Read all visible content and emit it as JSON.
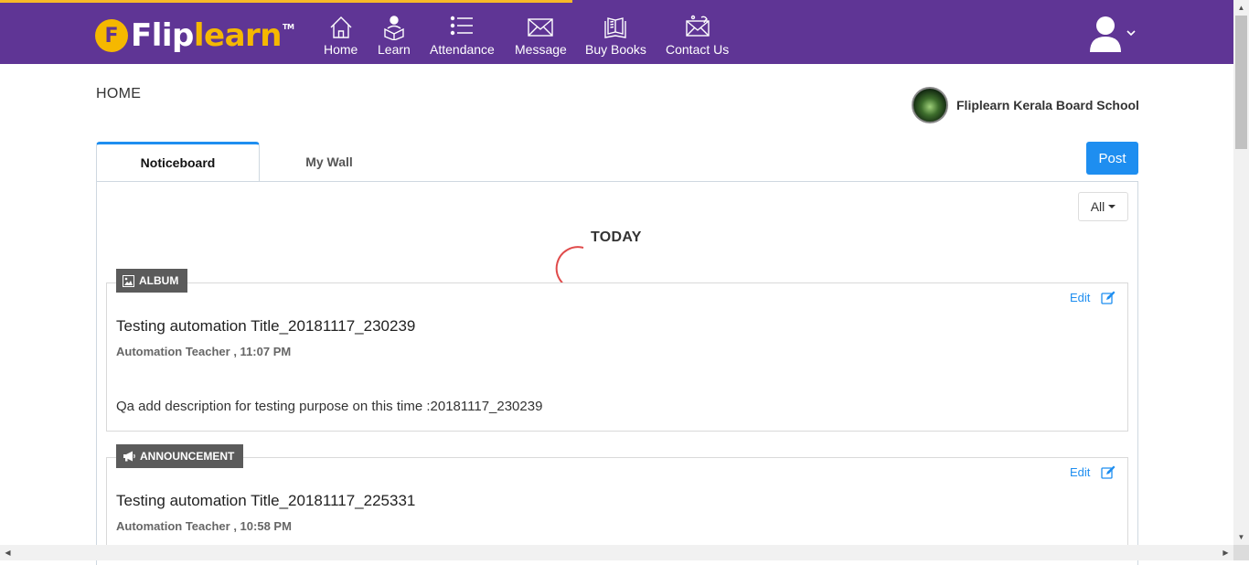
{
  "brand": {
    "part1": "Flip",
    "part2": "learn",
    "tm": "TM",
    "badge": "F"
  },
  "nav": {
    "home": "Home",
    "learn": "Learn",
    "attendance": "Attendance",
    "message": "Message",
    "buy_books": "Buy Books",
    "contact_us": "Contact Us"
  },
  "page": {
    "title": "HOME"
  },
  "school": {
    "name": "Fliplearn Kerala Board School"
  },
  "tabs": [
    {
      "label": "Noticeboard",
      "active": true
    },
    {
      "label": "My Wall",
      "active": false
    }
  ],
  "actions": {
    "post": "Post",
    "filter": "All"
  },
  "feed": {
    "section_label": "TODAY",
    "posts": [
      {
        "type": "ALBUM",
        "edit": "Edit",
        "title": "Testing automation Title_20181117_230239",
        "meta": "Automation Teacher , 11:07 PM",
        "description": "Qa add description for testing purpose on this time :20181117_230239"
      },
      {
        "type": "ANNOUNCEMENT",
        "edit": "Edit",
        "title": "Testing automation Title_20181117_225331",
        "meta": "Automation Teacher , 10:58 PM",
        "description": ""
      }
    ]
  },
  "colors": {
    "topbar": "#5f3595",
    "accent": "#1e8ef0",
    "brand_yellow": "#f5b800",
    "badge": "#5b5b5b"
  },
  "icons": {
    "home": "home-icon",
    "learn": "learn-icon",
    "attendance": "list-icon",
    "message": "envelope-icon",
    "buy_books": "books-icon",
    "contact_us": "contact-envelope-icon",
    "user": "user-avatar-icon",
    "album": "image-icon",
    "announcement": "megaphone-icon",
    "edit": "edit-icon"
  }
}
